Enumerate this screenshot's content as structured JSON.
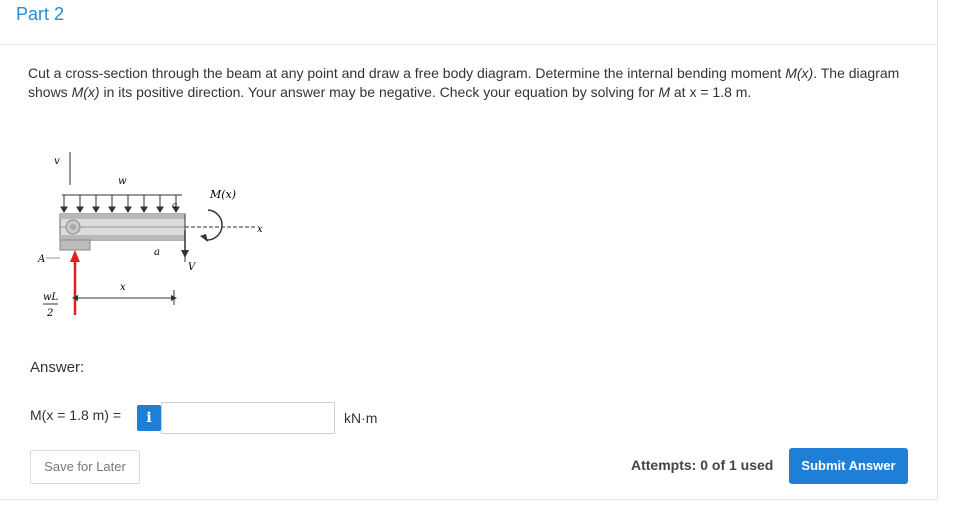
{
  "part": {
    "title": "Part 2"
  },
  "question": {
    "text_1": "Cut a cross-section through the beam at any point and draw a free body diagram. Determine the internal bending moment ",
    "italic_1": "M(x)",
    "text_2": ". The diagram shows ",
    "italic_2": "M(x)",
    "text_3": " in its positive direction. Your answer may be negative. Check your equation by solving for ",
    "italic_3": "M",
    "text_4": " at x = 1.8 m."
  },
  "figure": {
    "label_v_top": "v",
    "label_w": "w",
    "label_mx": "M(x)",
    "label_x_axis": "x",
    "label_a1": "a",
    "label_a2": "a",
    "label_A": "A",
    "label_V": "V",
    "label_x_dim": "x",
    "label_wL": "wL",
    "label_2": "2"
  },
  "answer": {
    "label": "Answer:",
    "eq_label": "M(x = 1.8 m) =",
    "info_icon_glyph": "i",
    "input_value": "",
    "unit": "kN·m"
  },
  "actions": {
    "save_label": "Save for Later",
    "attempts_text": "Attempts: 0 of 1 used",
    "submit_label": "Submit Answer"
  },
  "colors": {
    "accent": "#1f7fd6",
    "title": "#2a8bd6",
    "reaction_arrow": "#e02020"
  }
}
